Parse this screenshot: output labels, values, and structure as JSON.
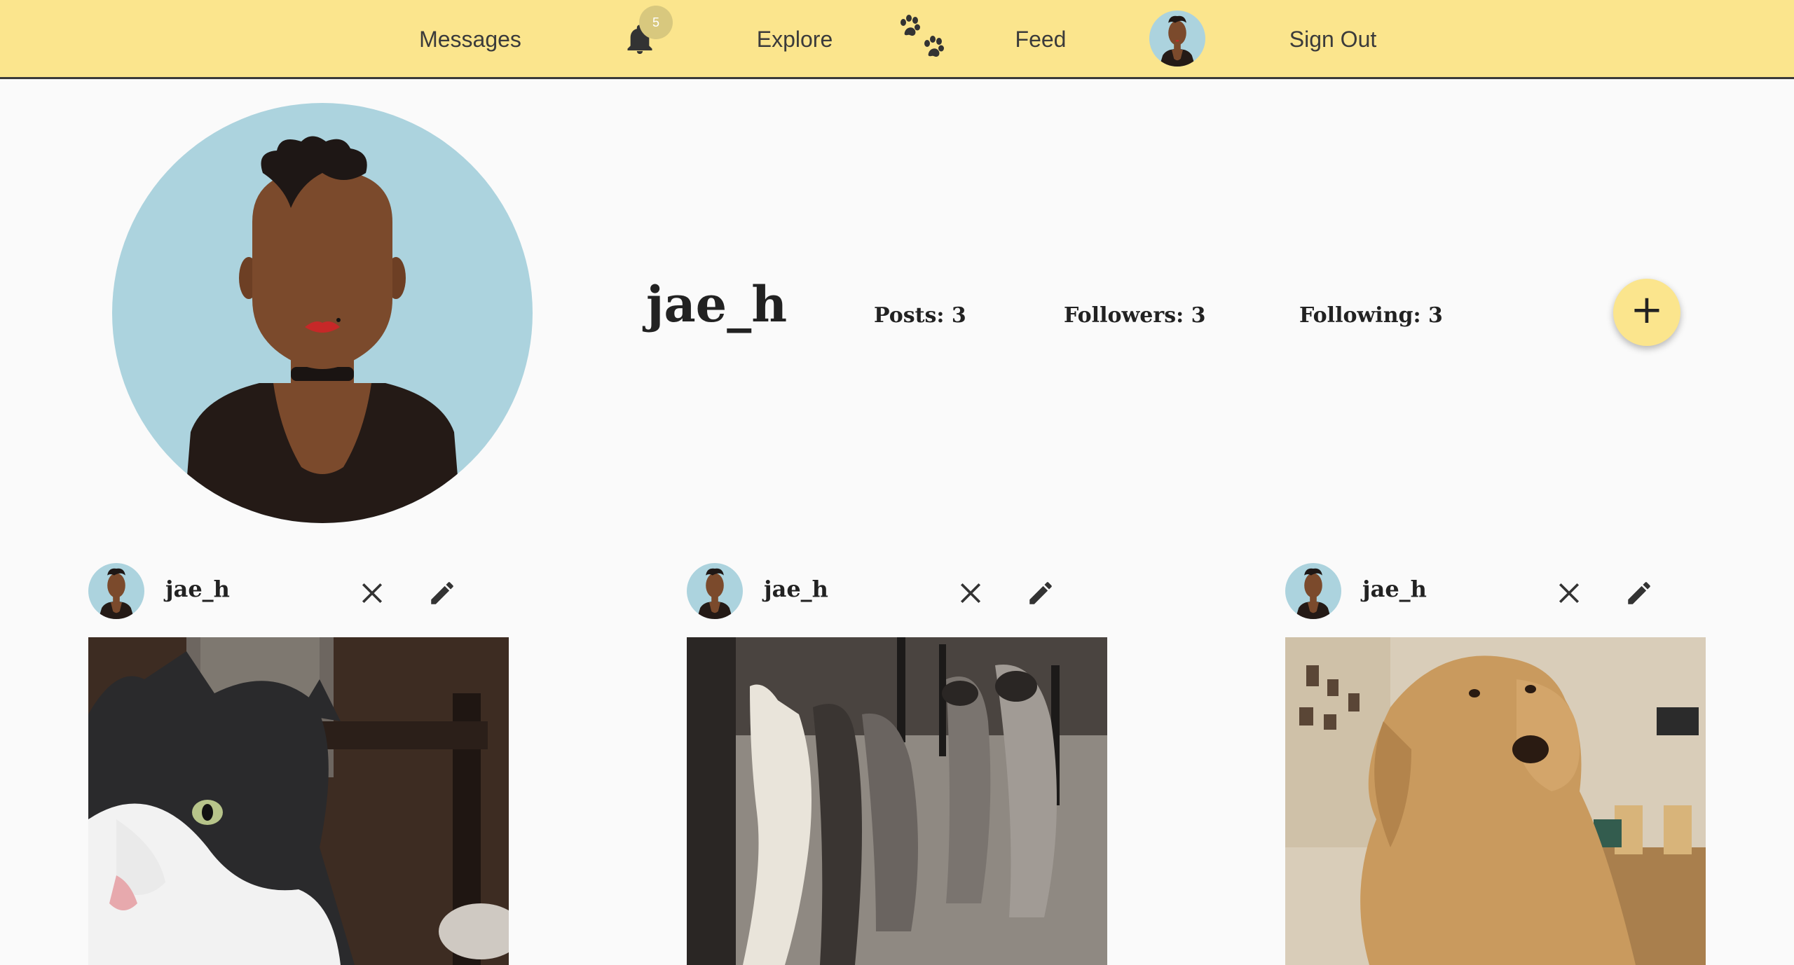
{
  "nav": {
    "messages": "Messages",
    "notification_count": "5",
    "explore": "Explore",
    "feed": "Feed",
    "sign_out": "Sign Out"
  },
  "profile": {
    "username": "jae_h",
    "posts": "Posts: 3",
    "followers": "Followers: 3",
    "following": "Following: 3",
    "add_label": "+"
  },
  "posts": [
    {
      "username": "jae_h",
      "photo": "cat-photo"
    },
    {
      "username": "jae_h",
      "photo": "raccoons-photo"
    },
    {
      "username": "jae_h",
      "photo": "golden-retriever-photo"
    }
  ],
  "colors": {
    "nav_bg": "#fbe58d",
    "page_bg": "#fafafa",
    "avatar_bg": "#acd3de"
  },
  "icons": [
    "bell-icon",
    "paw-icon",
    "close-icon",
    "pencil-icon",
    "plus-icon"
  ]
}
